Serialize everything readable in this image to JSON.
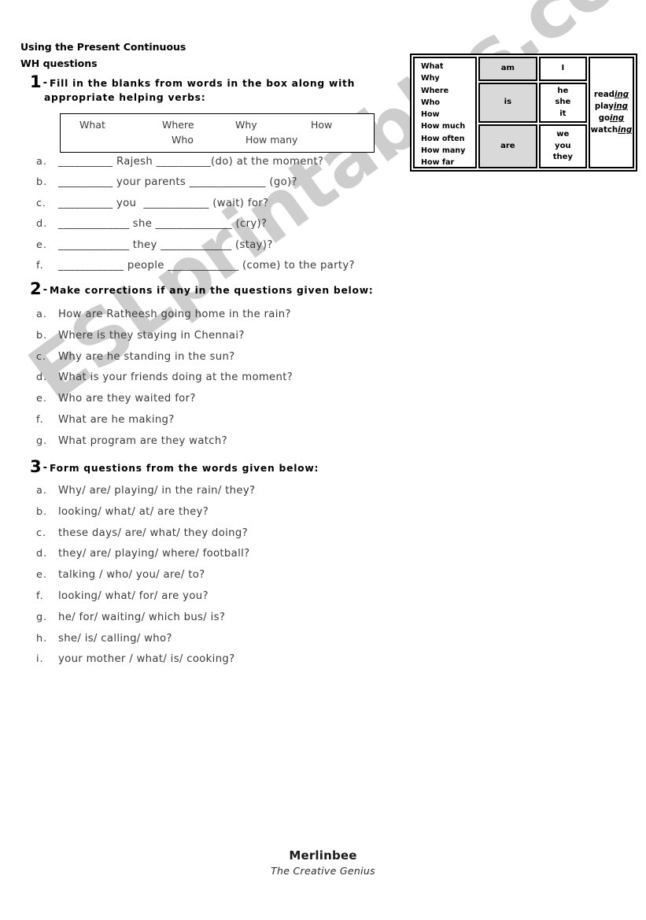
{
  "document": {
    "title_line1": "Using the Present Continuous",
    "title_line2": "WH questions"
  },
  "watermark": {
    "text": "ESLprintables.com",
    "color": "#cdcdcd"
  },
  "grammar_table": {
    "shade_color": "#d9d9d9",
    "wh_words": [
      "What",
      "Why",
      "Where",
      "Who",
      "How",
      "How much",
      "How often",
      "How many",
      "How far"
    ],
    "helping_verbs": [
      "am",
      "is",
      "are"
    ],
    "pronoun_groups": [
      [
        "I"
      ],
      [
        "he",
        "she",
        "it"
      ],
      [
        "we",
        "you",
        "they"
      ]
    ],
    "ing_verbs": [
      {
        "stem": "read",
        "suffix": "ing"
      },
      {
        "stem": "play",
        "suffix": "ing"
      },
      {
        "stem": "go",
        "suffix": "ing"
      },
      {
        "stem": "watch",
        "suffix": "ing"
      }
    ]
  },
  "sections": [
    {
      "number": "1",
      "dash": "-",
      "heading_line1": "Fill in the blanks from words in the box along with",
      "heading_line2": "appropriate helping verbs:",
      "word_box": {
        "row1": [
          "What",
          "Where",
          "Why",
          "How"
        ],
        "row2": [
          "Who",
          "How many"
        ]
      },
      "items": [
        {
          "label": "a.",
          "text": "__________ Rajesh __________(do) at the moment?"
        },
        {
          "label": "b.",
          "text": "__________ your parents ______________ (go)?"
        },
        {
          "label": "c.",
          "text": "__________ you  ____________ (wait) for?"
        },
        {
          "label": "d.",
          "text": "_____________ she ______________ (cry)?"
        },
        {
          "label": "e.",
          "text": "_____________ they _____________ (stay)?"
        },
        {
          "label": "f.",
          "text": "____________ people _____________ (come) to the party?"
        }
      ]
    },
    {
      "number": "2",
      "dash": "-",
      "heading_line1": "Make corrections if any in the questions given below:",
      "heading_line2": "",
      "items": [
        {
          "label": "a.",
          "text": "How are Ratheesh going home in the rain?"
        },
        {
          "label": "b.",
          "text": "Where is they staying in Chennai?"
        },
        {
          "label": "c.",
          "text": "Why are he standing in the sun?"
        },
        {
          "label": "d.",
          "text": "What is your friends doing at the moment?"
        },
        {
          "label": "e.",
          "text": "Who are they waited for?"
        },
        {
          "label": "f.",
          "text": "What are he making?"
        },
        {
          "label": "g.",
          "text": "What program are they watch?"
        }
      ]
    },
    {
      "number": "3",
      "dash": "-",
      "heading_line1": "Form questions from the words given below:",
      "heading_line2": "",
      "items": [
        {
          "label": "a.",
          "text": "Why/ are/ playing/ in the rain/ they?"
        },
        {
          "label": "b.",
          "text": "looking/ what/ at/ are they?"
        },
        {
          "label": "c.",
          "text": "these days/ are/ what/ they doing?"
        },
        {
          "label": "d.",
          "text": "they/ are/ playing/ where/ football?"
        },
        {
          "label": "e.",
          "text": "talking / who/ you/ are/ to?"
        },
        {
          "label": "f.",
          "text": "looking/ what/ for/ are you?"
        },
        {
          "label": "g.",
          "text": "he/ for/ waiting/ which bus/ is?"
        },
        {
          "label": "h.",
          "text": "she/ is/ calling/ who?"
        },
        {
          "label": "i.",
          "text": "your mother / what/ is/ cooking?"
        }
      ]
    }
  ],
  "footer": {
    "name": "Merlinbee",
    "tagline": "The Creative Genius"
  }
}
